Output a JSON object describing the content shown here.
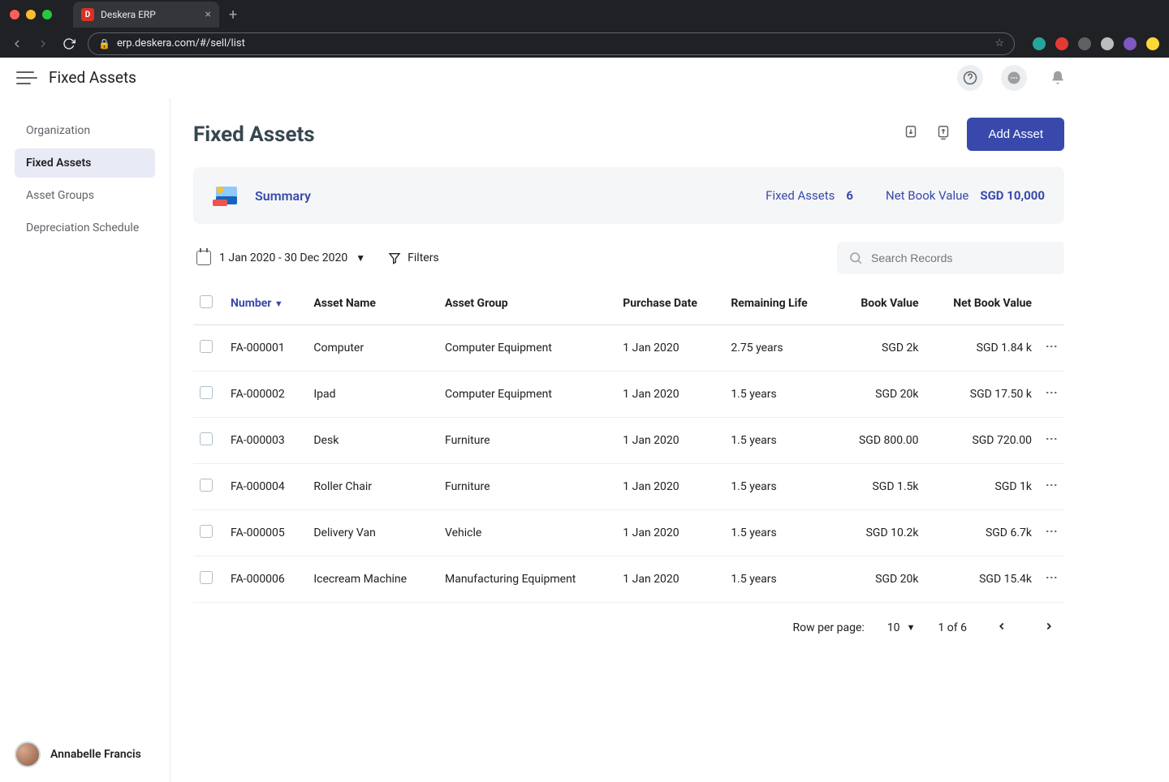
{
  "browser": {
    "tab_title": "Deskera ERP",
    "url": "erp.deskera.com/#/sell/list",
    "new_tab_label": "+"
  },
  "header": {
    "title": "Fixed Assets"
  },
  "sidebar": {
    "items": [
      {
        "label": "Organization",
        "active": false
      },
      {
        "label": "Fixed Assets",
        "active": true
      },
      {
        "label": "Asset Groups",
        "active": false
      },
      {
        "label": "Depreciation Schedule",
        "active": false
      }
    ],
    "user_name": "Annabelle Francis"
  },
  "page": {
    "title": "Fixed Assets",
    "add_button": "Add Asset"
  },
  "summary": {
    "label": "Summary",
    "stats": [
      {
        "label": "Fixed Assets",
        "value": "6"
      },
      {
        "label": "Net Book Value",
        "value": "SGD 10,000"
      }
    ]
  },
  "toolbar": {
    "date_range": "1 Jan 2020 - 30 Dec 2020",
    "filters_label": "Filters",
    "search_placeholder": "Search Records"
  },
  "table": {
    "columns": [
      "Number",
      "Asset Name",
      "Asset Group",
      "Purchase Date",
      "Remaining Life",
      "Book Value",
      "Net Book Value"
    ],
    "rows": [
      {
        "number": "FA-000001",
        "name": "Computer",
        "group": "Computer Equipment",
        "date": "1 Jan 2020",
        "life": "2.75 years",
        "book": "SGD 2k",
        "net": "SGD 1.84 k"
      },
      {
        "number": "FA-000002",
        "name": "Ipad",
        "group": "Computer Equipment",
        "date": "1 Jan 2020",
        "life": "1.5 years",
        "book": "SGD 20k",
        "net": "SGD 17.50 k"
      },
      {
        "number": "FA-000003",
        "name": "Desk",
        "group": "Furniture",
        "date": "1 Jan 2020",
        "life": "1.5 years",
        "book": "SGD 800.00",
        "net": "SGD 720.00"
      },
      {
        "number": "FA-000004",
        "name": "Roller Chair",
        "group": "Furniture",
        "date": "1 Jan 2020",
        "life": "1.5 years",
        "book": "SGD 1.5k",
        "net": "SGD 1k"
      },
      {
        "number": "FA-000005",
        "name": "Delivery Van",
        "group": "Vehicle",
        "date": "1 Jan 2020",
        "life": "1.5 years",
        "book": "SGD 10.2k",
        "net": "SGD 6.7k"
      },
      {
        "number": "FA-000006",
        "name": "Icecream Machine",
        "group": "Manufacturing Equipment",
        "date": "1 Jan 2020",
        "life": "1.5 years",
        "book": "SGD 20k",
        "net": "SGD 15.4k"
      }
    ]
  },
  "pager": {
    "rows_label": "Row per page:",
    "rows_value": "10",
    "range": "1 of 6"
  }
}
